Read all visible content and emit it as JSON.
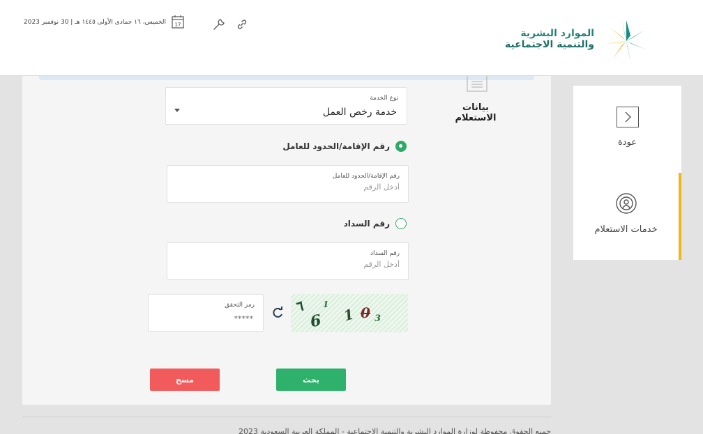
{
  "header": {
    "logo_line1": "الموارد البشرية",
    "logo_line2": "والتنمية الاجتماعية",
    "date_text": "الخميس، ١٦ جمادى الأولى ١٤٤٥ هـ | 30 نوفمبر 2023",
    "calendar_day": "17"
  },
  "side": {
    "back_label": "عودة",
    "services_label": "خدمات الاستعلام"
  },
  "form": {
    "section_title": "بيانات الاستعلام",
    "service_type_label": "نوع الخدمة",
    "service_type_value": "خدمة رخص العمل",
    "radio_iqama_label": "رقم الإقامة/الحدود للعامل",
    "iqama_field_label": "رقم الإقامة/الحدود للعامل",
    "iqama_placeholder": "أدخل الرقم",
    "radio_payment_label": "رقم السداد",
    "payment_field_label": "رقم السداد",
    "payment_placeholder": "أدخل الرقم",
    "captcha_label": "رمز التحقق",
    "captcha_value": "*****",
    "captcha_chars": [
      "٦",
      "1",
      "6",
      "1",
      "0",
      "3"
    ],
    "search_button": "بحث",
    "clear_button": "مسح"
  },
  "footer": {
    "text": "جميع الحقوق محفوظة لوزارة الموارد البشرية والتنمية الاجتماعية - المملكة العربية السعودية 2023"
  },
  "colors": {
    "accent_green": "#2eb26b",
    "clear_red": "#f25b5b",
    "active_side_border": "#f0b51d"
  }
}
